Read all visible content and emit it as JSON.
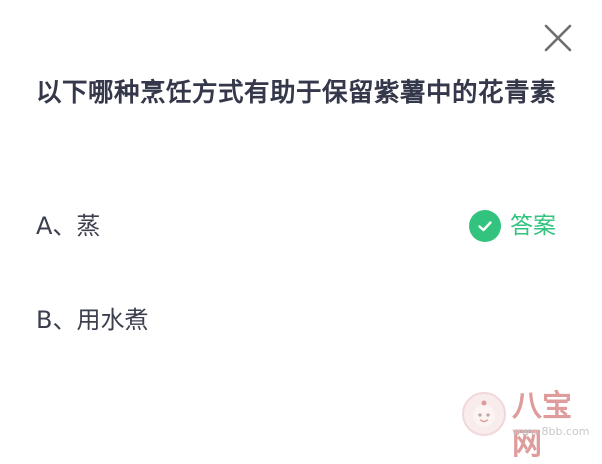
{
  "question": {
    "text": "以下哪种烹饪方式有助于保留紫薯中的花青素"
  },
  "options": [
    {
      "label": "A、蒸",
      "is_answer": true,
      "answer_label": "答案"
    },
    {
      "label": "B、用水煮",
      "is_answer": false
    }
  ],
  "close_icon": "close-icon",
  "answer_icon": "checkmark-icon",
  "colors": {
    "question_text": "#34384a",
    "option_text": "#3c3f4e",
    "accent_green": "#32c37f",
    "close_icon": "#6e6e6e"
  },
  "watermark": {
    "name": "八宝网",
    "url": "www.8bb.com"
  }
}
